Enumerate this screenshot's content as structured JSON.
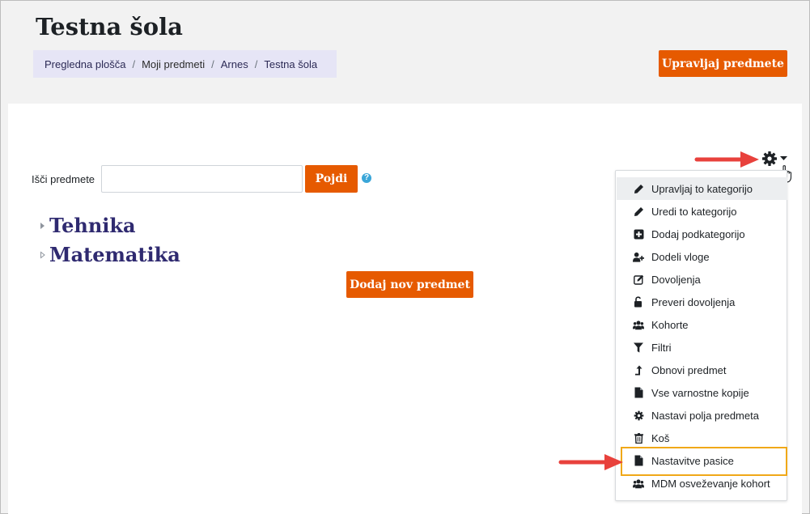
{
  "header": {
    "title": "Testna šola",
    "breadcrumb": [
      {
        "label": "Pregledna plošča",
        "link": true
      },
      {
        "label": "Moji predmeti",
        "link": false
      },
      {
        "label": "Arnes",
        "link": true
      },
      {
        "label": "Testna šola",
        "link": true
      }
    ],
    "manage_courses_label": "Upravljaj predmete"
  },
  "search": {
    "label": "Išči predmete",
    "value": "",
    "button_label": "Pojdi",
    "help_icon": "question-circle-icon"
  },
  "categories": [
    {
      "name": "Tehnika"
    },
    {
      "name": "Matematika"
    }
  ],
  "add_course_label": "Dodaj nov predmet",
  "actions_menu": {
    "trigger_icon": "gear-icon",
    "items": [
      {
        "label": "Upravljaj to kategorijo",
        "icon": "pencil-icon"
      },
      {
        "label": "Uredi to kategorijo",
        "icon": "pencil-icon"
      },
      {
        "label": "Dodaj podkategorijo",
        "icon": "plus-square-icon"
      },
      {
        "label": "Dodeli vloge",
        "icon": "user-plus-icon"
      },
      {
        "label": "Dovoljenja",
        "icon": "edit-square-icon"
      },
      {
        "label": "Preveri dovoljenja",
        "icon": "unlock-icon"
      },
      {
        "label": "Kohorte",
        "icon": "users-icon"
      },
      {
        "label": "Filtri",
        "icon": "filter-icon"
      },
      {
        "label": "Obnovi predmet",
        "icon": "level-up-icon"
      },
      {
        "label": "Vse varnostne kopije",
        "icon": "file-icon"
      },
      {
        "label": "Nastavi polja predmeta",
        "icon": "gear-icon"
      },
      {
        "label": "Koš",
        "icon": "trash-icon"
      },
      {
        "label": "Nastavitve pasice",
        "icon": "file-icon"
      },
      {
        "label": "MDM osveževanje kohort",
        "icon": "users-icon"
      }
    ]
  },
  "colors": {
    "accent": "#e65a00",
    "category_title": "#2f2a70",
    "breadcrumb_bg": "#e6e5f6",
    "annotation_arrow": "#e8413c",
    "highlight_box": "#f0a818"
  }
}
